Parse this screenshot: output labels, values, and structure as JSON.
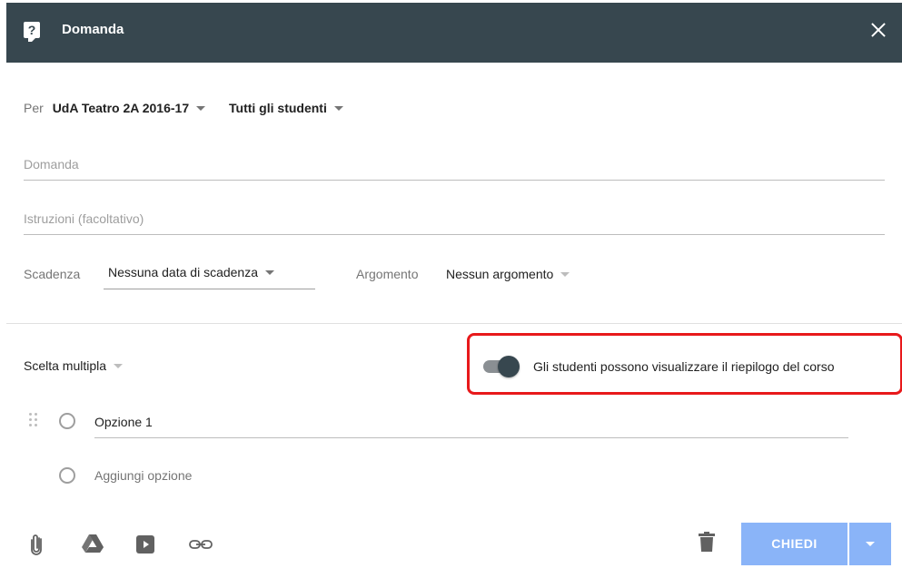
{
  "header": {
    "title": "Domanda",
    "icon": "question-icon",
    "close_icon": "close-icon"
  },
  "assign": {
    "per_label": "Per",
    "class_value": "UdA Teatro 2A 2016-17",
    "students_value": "Tutti gli studenti"
  },
  "question_field": {
    "placeholder": "Domanda",
    "value": ""
  },
  "instructions_field": {
    "placeholder": "Istruzioni (facoltativo)",
    "value": ""
  },
  "due": {
    "label": "Scadenza",
    "value": "Nessuna data di scadenza"
  },
  "topic": {
    "label": "Argomento",
    "value": "Nessun argomento"
  },
  "question_type": {
    "value": "Scelta multipla"
  },
  "summary_toggle": {
    "label": "Gli studenti possono visualizzare il riepilogo del corso",
    "on": true,
    "highlight_color": "#e8191b"
  },
  "options": [
    {
      "value": "Opzione 1"
    }
  ],
  "add_option_label": "Aggiungi opzione",
  "footer": {
    "icons": [
      "attach-icon",
      "drive-icon",
      "youtube-icon",
      "link-icon",
      "trash-icon"
    ],
    "submit_label": "CHIEDI"
  },
  "colors": {
    "header_bg": "#37474f",
    "submit_bg": "#8ab4f8"
  }
}
